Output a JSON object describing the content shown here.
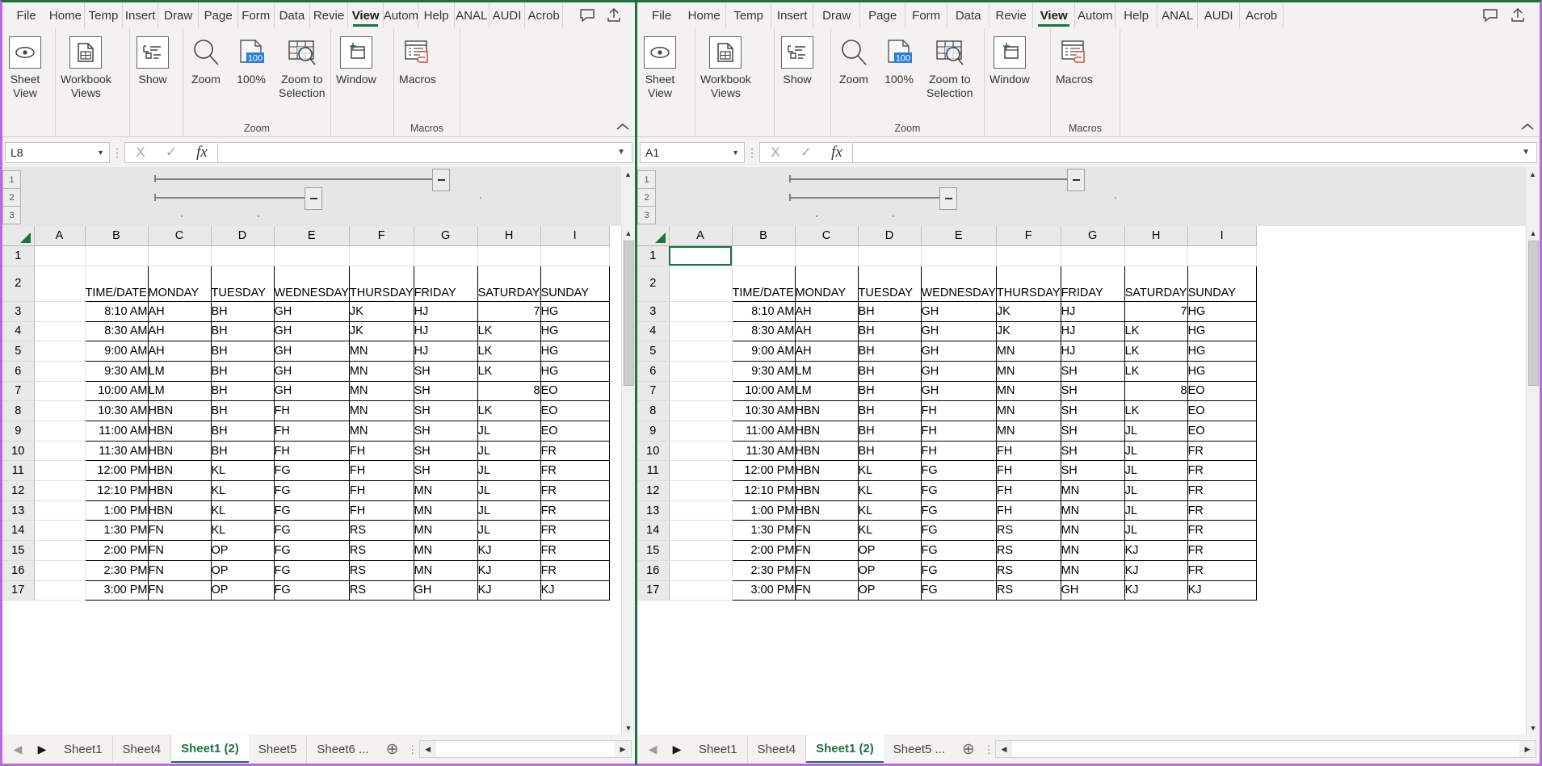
{
  "menu": {
    "items": [
      "File",
      "Home",
      "Temp",
      "Insert",
      "Draw",
      "Page",
      "Form",
      "Data",
      "Revie",
      "View",
      "Autom",
      "Help",
      "ANAL",
      "AUDI",
      "Acrob"
    ],
    "selected": "View",
    "comment_icon": "comment-icon",
    "share_icon": "share-icon"
  },
  "ribbon": {
    "groups": [
      {
        "name": "",
        "buttons": [
          {
            "label": "Sheet\nView",
            "icon": "eye-icon",
            "caret": true
          },
          {
            "label": "Workbook\nViews",
            "icon": "workbook-views-icon",
            "caret": true
          },
          {
            "label": "Show\n",
            "icon": "show-icon",
            "caret": true
          }
        ]
      },
      {
        "name": "Zoom",
        "buttons": [
          {
            "label": "Zoom",
            "icon": "magnifier-icon",
            "caret": false
          },
          {
            "label": "100%",
            "icon": "zoom-100-icon",
            "caret": false
          },
          {
            "label": "Zoom to\nSelection",
            "icon": "zoom-to-selection-icon",
            "caret": false
          }
        ]
      },
      {
        "name": "",
        "buttons": [
          {
            "label": "Window",
            "icon": "new-window-icon",
            "caret": true
          }
        ]
      },
      {
        "name": "Macros",
        "buttons": [
          {
            "label": "Macros",
            "icon": "macros-icon",
            "caret": true
          }
        ]
      }
    ],
    "collapse_label": "^"
  },
  "formula_bar": {
    "cancel": "X",
    "enter": "✓",
    "fx": "fx",
    "value": "",
    "placeholder": "",
    "dropdown_caret": "⌄"
  },
  "outline": {
    "levels": [
      "1",
      "2",
      "3"
    ]
  },
  "panes": {
    "left": {
      "name_box": "L8",
      "columns": [
        "A",
        "B",
        "C",
        "D",
        "E",
        "F",
        "G",
        "H",
        "I"
      ],
      "rows": [
        "1",
        "2",
        "3",
        "4",
        "5",
        "6",
        "7",
        "8",
        "9",
        "10",
        "11",
        "12",
        "13",
        "14",
        "15",
        "16",
        "17"
      ],
      "selected_cell": null,
      "tabs": [
        "Sheet1",
        "Sheet4",
        "Sheet1 (2)",
        "Sheet5",
        "Sheet6 ..."
      ],
      "active_tab": "Sheet1 (2)"
    },
    "right": {
      "name_box": "A1",
      "columns": [
        "A",
        "B",
        "C",
        "D",
        "E",
        "F",
        "G",
        "H",
        "I"
      ],
      "rows": [
        "1",
        "2",
        "3",
        "4",
        "5",
        "6",
        "7",
        "8",
        "9",
        "10",
        "11",
        "12",
        "13",
        "14",
        "15",
        "16",
        "17"
      ],
      "selected_cell": "A1",
      "tabs": [
        "Sheet1",
        "Sheet4",
        "Sheet1 (2)",
        "Sheet5 ..."
      ],
      "active_tab": "Sheet1 (2)"
    }
  },
  "sheet": {
    "headers": [
      "TIME/DATE",
      "MONDAY",
      "TUESDAY",
      "WEDNESDAY",
      "THURSDAY",
      "FRIDAY",
      "SATURDAY",
      "SUNDAY"
    ],
    "rows": [
      [
        "8:10 AM",
        "AH",
        "BH",
        "GH",
        "JK",
        "HJ",
        "7",
        "HG"
      ],
      [
        "8:30 AM",
        "AH",
        "BH",
        "GH",
        "JK",
        "HJ",
        "LK",
        "HG"
      ],
      [
        "9:00 AM",
        "AH",
        "BH",
        "GH",
        "MN",
        "HJ",
        "LK",
        "HG"
      ],
      [
        "9:30 AM",
        "LM",
        "BH",
        "GH",
        "MN",
        "SH",
        "LK",
        "HG"
      ],
      [
        "10:00 AM",
        "LM",
        "BH",
        "GH",
        "MN",
        "SH",
        "8",
        "EO"
      ],
      [
        "10:30 AM",
        "HBN",
        "BH",
        "FH",
        "MN",
        "SH",
        "LK",
        "EO"
      ],
      [
        "11:00 AM",
        "HBN",
        "BH",
        "FH",
        "MN",
        "SH",
        "JL",
        "EO"
      ],
      [
        "11:30 AM",
        "HBN",
        "BH",
        "FH",
        "FH",
        "SH",
        "JL",
        "FR"
      ],
      [
        "12:00 PM",
        "HBN",
        "KL",
        "FG",
        "FH",
        "SH",
        "JL",
        "FR"
      ],
      [
        "12:10 PM",
        "HBN",
        "KL",
        "FG",
        "FH",
        "MN",
        "JL",
        "FR"
      ],
      [
        "1:00 PM",
        "HBN",
        "KL",
        "FG",
        "FH",
        "MN",
        "JL",
        "FR"
      ],
      [
        "1:30 PM",
        "FN",
        "KL",
        "FG",
        "RS",
        "MN",
        "JL",
        "FR"
      ],
      [
        "2:00 PM",
        "FN",
        "OP",
        "FG",
        "RS",
        "MN",
        "KJ",
        "FR"
      ],
      [
        "2:30 PM",
        "FN",
        "OP",
        "FG",
        "RS",
        "MN",
        "KJ",
        "FR"
      ],
      [
        "3:00 PM",
        "FN",
        "OP",
        "FG",
        "RS",
        "GH",
        "KJ",
        "KJ"
      ]
    ],
    "numeric_cells": [
      "7",
      "8"
    ]
  },
  "colors": {
    "accent": "#1e7145",
    "window_border": "#b96ae0",
    "ribbon_bg": "#f3f2f1",
    "header_bg": "#e9e9e9",
    "blue_badge": "#2a7fd4",
    "macro_red": "#d04a35"
  }
}
